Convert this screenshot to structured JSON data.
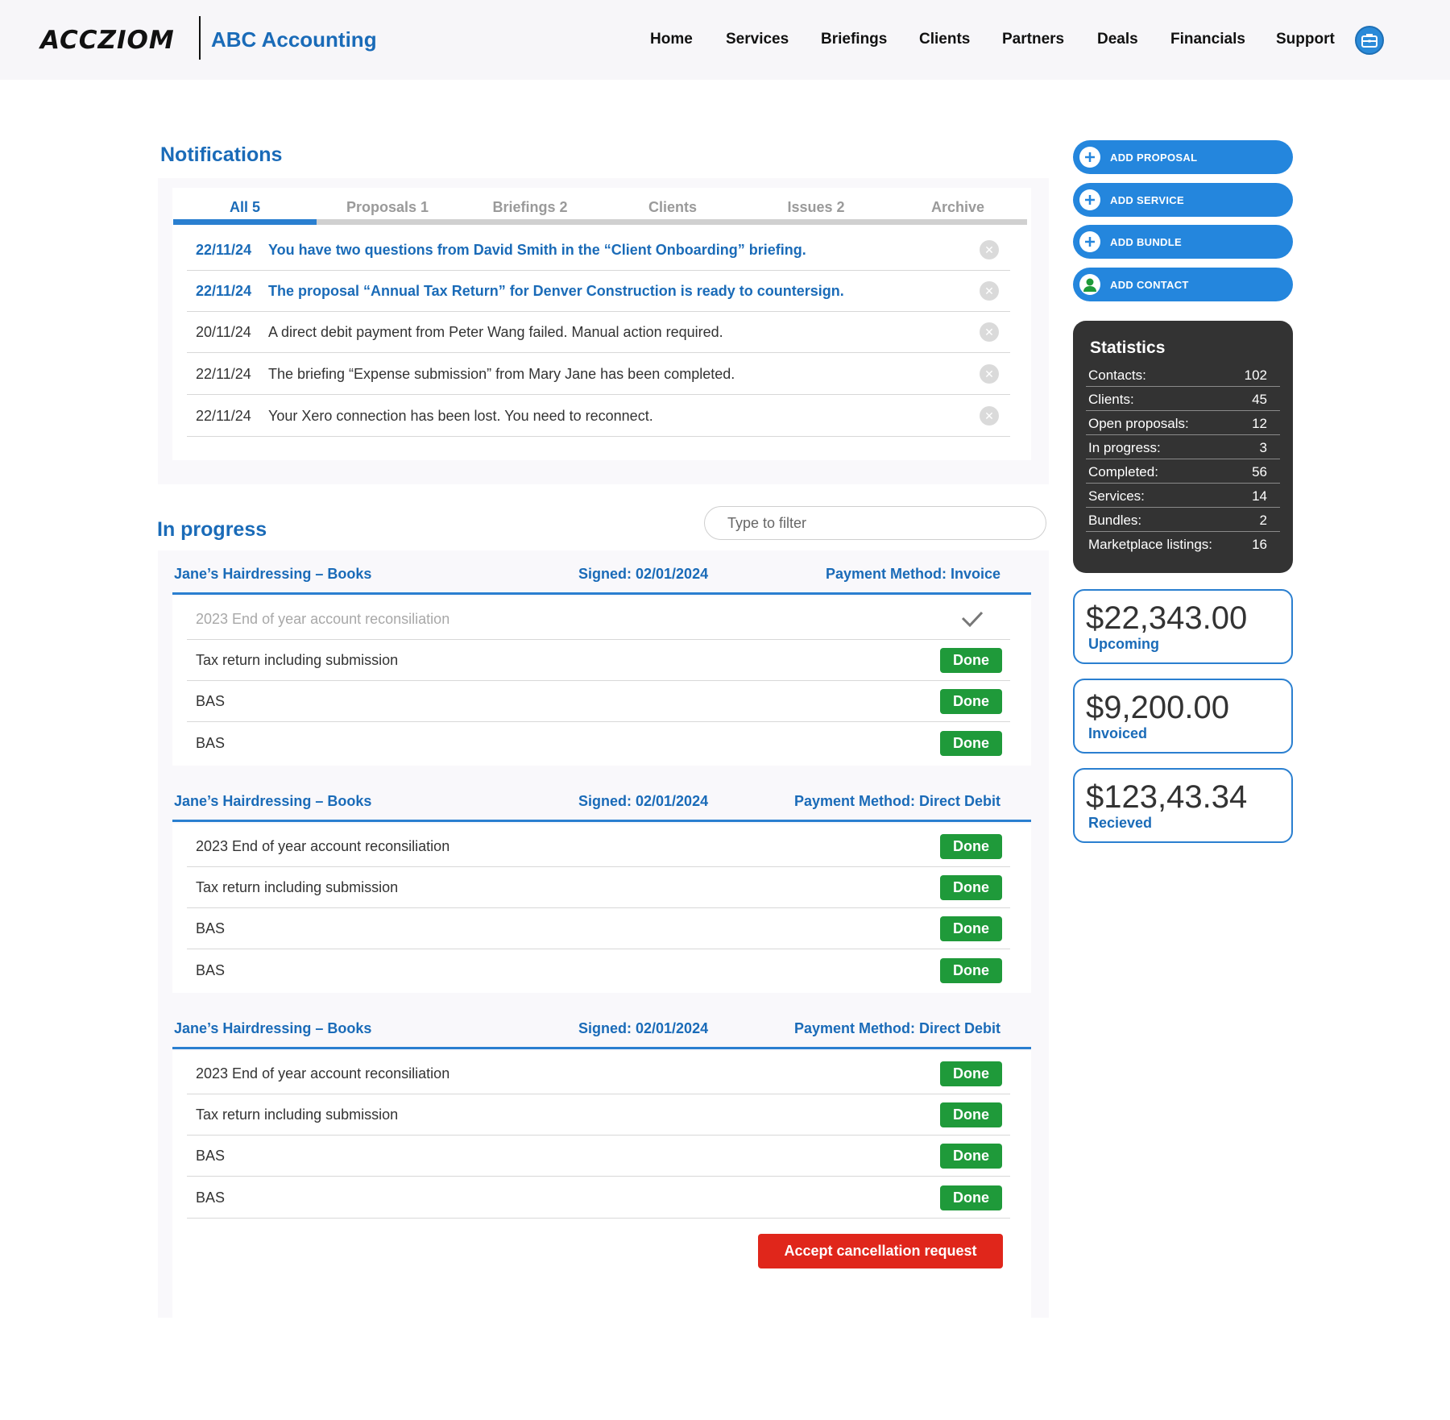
{
  "brand": {
    "logo": "ACCZIOM",
    "org_name": "ABC Accounting"
  },
  "nav": [
    "Home",
    "Services",
    "Briefings",
    "Clients",
    "Partners",
    "Deals",
    "Financials",
    "Support"
  ],
  "notifications": {
    "title": "Notifications",
    "tabs": [
      "All 5",
      "Proposals 1",
      "Briefings 2",
      "Clients",
      "Issues 2",
      "Archive"
    ],
    "active_tab": 0,
    "items": [
      {
        "date": "22/11/24",
        "text": "You have two questions from David Smith in the “Client Onboarding” briefing.",
        "unread": true
      },
      {
        "date": "22/11/24",
        "text": "The proposal “Annual Tax Return” for Denver Construction is ready to countersign.",
        "unread": true
      },
      {
        "date": "20/11/24",
        "text": "A direct debit payment from Peter Wang failed. Manual action required.",
        "unread": false
      },
      {
        "date": "22/11/24",
        "text": "The briefing “Expense submission” from Mary Jane has been completed.",
        "unread": false
      },
      {
        "date": "22/11/24",
        "text": "Your Xero connection has been lost. You need to reconnect.",
        "unread": false
      }
    ]
  },
  "in_progress": {
    "title": "In progress",
    "filter_placeholder": "Type to filter",
    "done_label": "Done",
    "groups": [
      {
        "name": "Jane’s Hairdressing – Books",
        "signed": "Signed: 02/01/2024",
        "payment": "Payment Method: Invoice",
        "tasks": [
          {
            "name": "2023 End of year account reconsiliation",
            "state": "complete"
          },
          {
            "name": "Tax return including submission",
            "state": "done"
          },
          {
            "name": "BAS",
            "state": "done"
          },
          {
            "name": "BAS",
            "state": "done"
          }
        ]
      },
      {
        "name": "Jane’s Hairdressing – Books",
        "signed": "Signed: 02/01/2024",
        "payment": "Payment Method: Direct Debit",
        "tasks": [
          {
            "name": "2023 End of year account reconsiliation",
            "state": "done"
          },
          {
            "name": "Tax return including submission",
            "state": "done"
          },
          {
            "name": "BAS",
            "state": "done"
          },
          {
            "name": "BAS",
            "state": "done"
          }
        ]
      },
      {
        "name": "Jane’s Hairdressing – Books",
        "signed": "Signed: 02/01/2024",
        "payment": "Payment Method: Direct Debit",
        "tasks": [
          {
            "name": "2023 End of year account reconsiliation",
            "state": "done"
          },
          {
            "name": "Tax return including submission",
            "state": "done"
          },
          {
            "name": "BAS",
            "state": "done"
          },
          {
            "name": "BAS",
            "state": "done"
          }
        ]
      }
    ],
    "cancel_label": "Accept cancellation request"
  },
  "actions": [
    {
      "label": "ADD PROPOSAL",
      "icon": "plus-icon"
    },
    {
      "label": "ADD SERVICE",
      "icon": "plus-icon"
    },
    {
      "label": "ADD BUNDLE",
      "icon": "plus-icon"
    },
    {
      "label": "ADD CONTACT",
      "icon": "person-icon"
    }
  ],
  "statistics": {
    "title": "Statistics",
    "rows": [
      {
        "label": "Contacts:",
        "value": "102"
      },
      {
        "label": "Clients:",
        "value": "45"
      },
      {
        "label": "Open proposals:",
        "value": "12"
      },
      {
        "label": "In progress:",
        "value": "3"
      },
      {
        "label": "Completed:",
        "value": "56"
      },
      {
        "label": "Services:",
        "value": "14"
      },
      {
        "label": "Bundles:",
        "value": "2"
      },
      {
        "label": "Marketplace listings:",
        "value": "16"
      }
    ]
  },
  "money": [
    {
      "amount": "$22,343.00",
      "label": "Upcoming"
    },
    {
      "amount": "$9,200.00",
      "label": "Invoiced"
    },
    {
      "amount": "$123,43.34",
      "label": "Recieved"
    }
  ],
  "colors": {
    "brand_blue": "#1a6bb8",
    "accent_blue": "#2486dd",
    "done_green": "#1f9a3a",
    "cancel_red": "#e0261b",
    "stats_bg": "#333333"
  }
}
